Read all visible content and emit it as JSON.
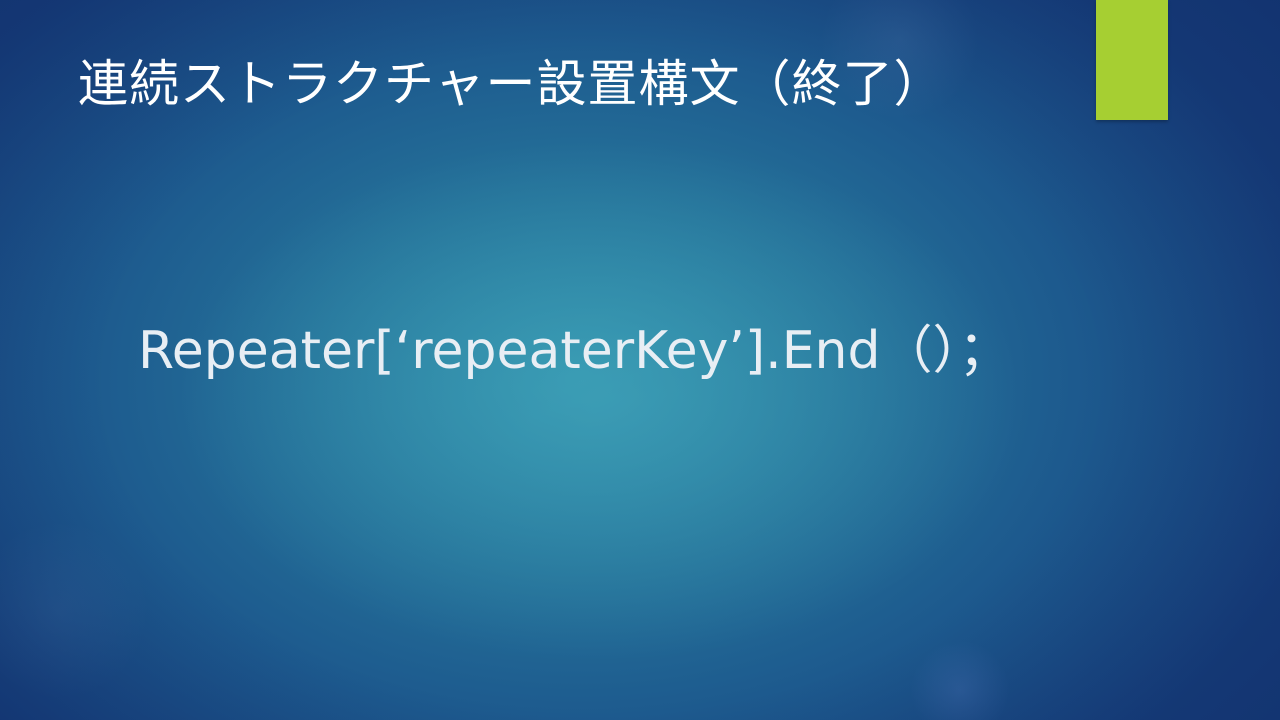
{
  "slide": {
    "title": "連続ストラクチャー設置構文（終了）",
    "body_text": "Repeater[‘repeaterKey’].End（）；",
    "accent_color": "#a6cf32"
  }
}
